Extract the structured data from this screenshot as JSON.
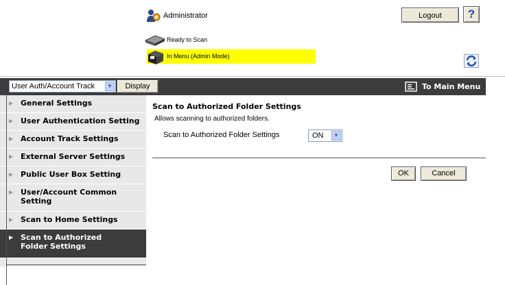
{
  "header": {
    "user_label": "Administrator",
    "logout_label": "Logout",
    "help_label": "?",
    "status_ready": "Ready to Scan",
    "status_mode": "In Menu (Admin Mode)"
  },
  "navbar": {
    "mode_select_value": "User Auth/Account Track",
    "display_label": "Display",
    "main_menu_label": "To Main Menu"
  },
  "sidebar": {
    "items": [
      {
        "label": "General Settings"
      },
      {
        "label": "User Authentication Setting"
      },
      {
        "label": "Account Track Settings"
      },
      {
        "label": "External Server Settings"
      },
      {
        "label": "Public User Box Setting"
      },
      {
        "label": "User/Account Common Setting"
      },
      {
        "label": "Scan to Home Settings"
      },
      {
        "label": "Scan to Authorized Folder Settings"
      }
    ]
  },
  "main": {
    "title": "Scan to Authorized Folder Settings",
    "description": "Allows scanning to authorized folders.",
    "field_label": "Scan to Authorized Folder Settings",
    "field_value": "ON",
    "ok_label": "OK",
    "cancel_label": "Cancel"
  },
  "colors": {
    "navbar_bg": "#3c3c3c",
    "sidebar_bg": "#e8e8e8",
    "status_highlight": "#ffff00"
  }
}
